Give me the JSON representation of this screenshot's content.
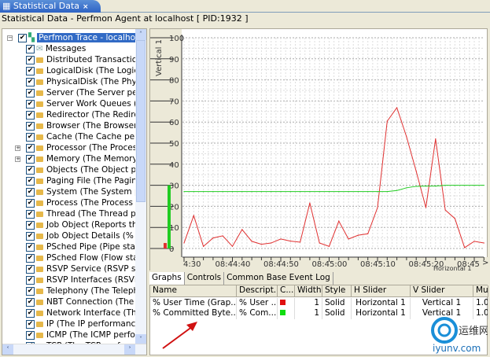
{
  "tab": {
    "label": "Statistical Data",
    "close": "×"
  },
  "title": "Statistical Data - Perfmon Agent at localhost [ PID:1932 ]",
  "tree": {
    "root": "Perfmon Trace - localhost (lo",
    "items": [
      {
        "label": "Messages",
        "icon": "envelope"
      },
      {
        "label": "Distributed Transaction C"
      },
      {
        "label": "LogicalDisk (The Logical D"
      },
      {
        "label": "PhysicalDisk (The Physica"
      },
      {
        "label": "Server (The Server perfor"
      },
      {
        "label": "Server Work Queues (The"
      },
      {
        "label": "Redirector (The Redirecto"
      },
      {
        "label": "Browser (The Browser pe"
      },
      {
        "label": "Cache (The Cache perforr"
      },
      {
        "label": "Processor (The Processor",
        "expandable": true
      },
      {
        "label": "Memory (The Memory pe",
        "expandable": true
      },
      {
        "label": "Objects (The Object perfo"
      },
      {
        "label": "Paging File (The Paging F"
      },
      {
        "label": "System (The System perfo"
      },
      {
        "label": "Process (The Process perf"
      },
      {
        "label": "Thread (The Thread perfo"
      },
      {
        "label": "Job Object (Reports the a"
      },
      {
        "label": "Job Object Details (% Job"
      },
      {
        "label": "PSched Pipe (Pipe statistic"
      },
      {
        "label": "PSched Flow (Flow statist"
      },
      {
        "label": "RSVP Service (RSVP servi"
      },
      {
        "label": "RSVP Interfaces (RSVP In"
      },
      {
        "label": "Telephony (The Telephor"
      },
      {
        "label": "NBT Connection (The NBT"
      },
      {
        "label": "Network Interface (The N"
      },
      {
        "label": "IP (The IP performance c"
      },
      {
        "label": "ICMP (The ICMP perform"
      },
      {
        "label": "TCP (The TCP perform"
      }
    ],
    "check": "✔"
  },
  "chart_data": {
    "type": "line",
    "ylabel": "Vertical 1",
    "xlabel": "Horizontal 1",
    "ylim": [
      0,
      100
    ],
    "yticks": [
      0,
      10,
      20,
      30,
      40,
      50,
      60,
      70,
      80,
      90,
      100
    ],
    "xtick_labels": [
      "4:30",
      "08:44:40",
      "08:44:50",
      "08:45:00",
      "08:45:10",
      "08:45:20",
      "08:45"
    ],
    "x_start": "08:44:30",
    "x_step_seconds": 2,
    "grid": true,
    "series": [
      {
        "name": "% User Time",
        "color": "#e03030",
        "values": [
          2.6,
          15.6,
          1,
          5,
          6,
          1,
          9,
          3.4,
          2,
          2.6,
          4.5,
          3.5,
          3,
          21.6,
          2.6,
          1,
          13,
          4.5,
          6.3,
          7,
          19.4,
          60.4,
          66.8,
          53,
          36.6,
          19.4,
          52,
          18.3,
          14.2,
          0.4,
          3.4,
          2.6
        ],
        "current": 2.6
      },
      {
        "name": "% Committed Bytes",
        "color": "#22cc22",
        "values": [
          27,
          27,
          27,
          27,
          27,
          27,
          27,
          27,
          27,
          27,
          27,
          27,
          27,
          27,
          27,
          27,
          27,
          27,
          27,
          27,
          27,
          27,
          27.5,
          28.8,
          29.5,
          29.6,
          29.6,
          30,
          30,
          30,
          30,
          30
        ],
        "current": 30
      }
    ]
  },
  "bottom_tabs": [
    "Graphs",
    "Controls",
    "Common Base Event Log"
  ],
  "table": {
    "columns": [
      "Name",
      "Descript...",
      "C...",
      "Width",
      "Style",
      "H Slider",
      "V Slider",
      "Mu..."
    ],
    "rows": [
      {
        "name": "% User Time (Grap...",
        "desc": "% User ...",
        "color": "#e01010",
        "width": "1",
        "style": "Solid",
        "h": "Horizontal 1",
        "v": "Vertical 1",
        "mu": "1.0"
      },
      {
        "name": "% Committed Byte...",
        "desc": "% Com...",
        "color": "#10dd10",
        "width": "1",
        "style": "Solid",
        "h": "Horizontal 1",
        "v": "Vertical 1",
        "mu": "1.0"
      }
    ]
  },
  "watermark": {
    "cn": "运维网",
    "url": "iyunv.com"
  }
}
